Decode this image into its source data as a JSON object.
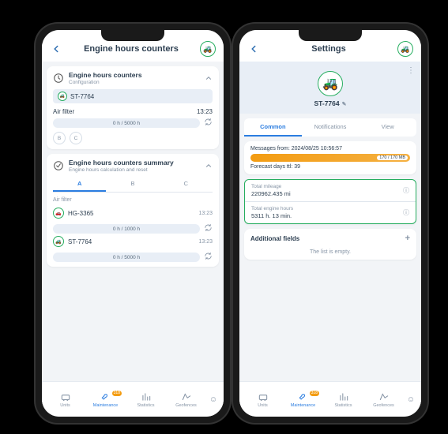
{
  "phone1": {
    "title": "Engine hours counters",
    "card1": {
      "title": "Engine hours counters",
      "sub": "Configuration",
      "unit": "ST-7764",
      "item": "Air filter",
      "time": "13:23",
      "bar": "0 h  /  5000 h",
      "letters": [
        "B",
        "C"
      ]
    },
    "card2": {
      "title": "Engine hours counters summary",
      "sub": "Engine hours calculation and reset",
      "tabs": [
        "A",
        "B",
        "C"
      ],
      "section": "Air filter",
      "units": [
        {
          "name": "HG-3365",
          "time": "13:23",
          "bar": "0 h  /  1000 h"
        },
        {
          "name": "ST-7764",
          "time": "13:23",
          "bar": "0 h  /  5000 h"
        }
      ]
    }
  },
  "phone2": {
    "title": "Settings",
    "unit": "ST-7764",
    "tabs": [
      "Common",
      "Notifications",
      "View"
    ],
    "msg_label": "Messages from: 2024/08/25 10:56:57",
    "usage_chip": "170 / 170 MB",
    "forecast": "Forecast days ttl: 39",
    "metrics": [
      {
        "label": "Total mileage",
        "value": "220962.435 mi"
      },
      {
        "label": "Total engine hours",
        "value": "5311 h. 13 min."
      }
    ],
    "add_title": "Additional fields",
    "empty": "The list is empty."
  },
  "nav": {
    "items": [
      "Units",
      "Maintenance",
      "Statistics",
      "Geofences"
    ],
    "badge": "318"
  }
}
